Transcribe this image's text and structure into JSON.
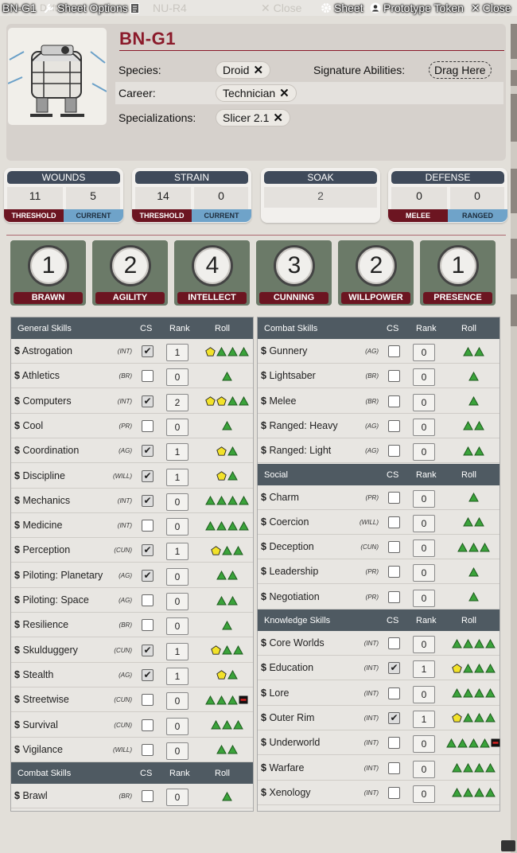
{
  "titlebar": {
    "name": "BN-G1",
    "sheet_options": "Sheet Options",
    "ghost_tab1": "Drift Rock",
    "ghost_tab2": "NU-R4",
    "ghost_close": "Close",
    "sheet": "Sheet",
    "prototype_token": "Prototype Token",
    "close": "Close"
  },
  "character": {
    "name": "BN-G1",
    "species_label": "Species:",
    "species": "Droid",
    "career_label": "Career:",
    "career": "Technician",
    "spec_label": "Specializations:",
    "specialization": "Slicer 2.1",
    "sig_label": "Signature Abilities:",
    "sig_drop": "Drag Here"
  },
  "stats": {
    "wounds": {
      "title": "WOUNDS",
      "threshold": "11",
      "current": "5",
      "l1": "THRESHOLD",
      "l2": "CURRENT"
    },
    "strain": {
      "title": "STRAIN",
      "threshold": "14",
      "current": "0",
      "l1": "THRESHOLD",
      "l2": "CURRENT"
    },
    "soak": {
      "title": "SOAK",
      "value": "2"
    },
    "defense": {
      "title": "DEFENSE",
      "melee": "0",
      "ranged": "0",
      "l1": "MELEE",
      "l2": "RANGED"
    }
  },
  "characteristics": [
    {
      "name": "BRAWN",
      "value": "1"
    },
    {
      "name": "AGILITY",
      "value": "2"
    },
    {
      "name": "INTELLECT",
      "value": "4"
    },
    {
      "name": "CUNNING",
      "value": "3"
    },
    {
      "name": "WILLPOWER",
      "value": "2"
    },
    {
      "name": "PRESENCE",
      "value": "1"
    }
  ],
  "columns": {
    "cs": "CS",
    "rank": "Rank",
    "roll": "Roll"
  },
  "colors": {
    "ability": "#3aa33a",
    "proficiency": "#f2e22a",
    "setback": "#111111",
    "header": "#4f5a62",
    "accent": "#8b1a2a"
  },
  "left_column": [
    {
      "section": "General Skills",
      "rows": [
        {
          "name": "Astrogation",
          "char": "(INT)",
          "cs": true,
          "rank": "1",
          "dice": "YGGG"
        },
        {
          "name": "Athletics",
          "char": "(BR)",
          "cs": false,
          "rank": "0",
          "dice": "G"
        },
        {
          "name": "Computers",
          "char": "(INT)",
          "cs": true,
          "rank": "2",
          "dice": "YYGG"
        },
        {
          "name": "Cool",
          "char": "(PR)",
          "cs": false,
          "rank": "0",
          "dice": "G"
        },
        {
          "name": "Coordination",
          "char": "(AG)",
          "cs": true,
          "rank": "1",
          "dice": "YG"
        },
        {
          "name": "Discipline",
          "char": "(WILL)",
          "cs": true,
          "rank": "1",
          "dice": "YG"
        },
        {
          "name": "Mechanics",
          "char": "(INT)",
          "cs": true,
          "rank": "0",
          "dice": "GGGG"
        },
        {
          "name": "Medicine",
          "char": "(INT)",
          "cs": false,
          "rank": "0",
          "dice": "GGGG"
        },
        {
          "name": "Perception",
          "char": "(CUN)",
          "cs": true,
          "rank": "1",
          "dice": "YGG"
        },
        {
          "name": "Piloting: Planetary",
          "char": "(AG)",
          "cs": true,
          "rank": "0",
          "dice": "GG"
        },
        {
          "name": "Piloting: Space",
          "char": "(AG)",
          "cs": false,
          "rank": "0",
          "dice": "GG"
        },
        {
          "name": "Resilience",
          "char": "(BR)",
          "cs": false,
          "rank": "0",
          "dice": "G"
        },
        {
          "name": "Skulduggery",
          "char": "(CUN)",
          "cs": true,
          "rank": "1",
          "dice": "YGG"
        },
        {
          "name": "Stealth",
          "char": "(AG)",
          "cs": true,
          "rank": "1",
          "dice": "YG"
        },
        {
          "name": "Streetwise",
          "char": "(CUN)",
          "cs": false,
          "rank": "0",
          "dice": "GGGS"
        },
        {
          "name": "Survival",
          "char": "(CUN)",
          "cs": false,
          "rank": "0",
          "dice": "GGG"
        },
        {
          "name": "Vigilance",
          "char": "(WILL)",
          "cs": false,
          "rank": "0",
          "dice": "GG"
        }
      ]
    },
    {
      "section": "Combat Skills",
      "rows": [
        {
          "name": "Brawl",
          "char": "(BR)",
          "cs": false,
          "rank": "0",
          "dice": "G"
        }
      ]
    }
  ],
  "right_column": [
    {
      "section": "Combat Skills",
      "rows": [
        {
          "name": "Gunnery",
          "char": "(AG)",
          "cs": false,
          "rank": "0",
          "dice": "GG"
        },
        {
          "name": "Lightsaber",
          "char": "(BR)",
          "cs": false,
          "rank": "0",
          "dice": "G"
        },
        {
          "name": "Melee",
          "char": "(BR)",
          "cs": false,
          "rank": "0",
          "dice": "G"
        },
        {
          "name": "Ranged: Heavy",
          "char": "(AG)",
          "cs": false,
          "rank": "0",
          "dice": "GG"
        },
        {
          "name": "Ranged: Light",
          "char": "(AG)",
          "cs": false,
          "rank": "0",
          "dice": "GG"
        }
      ]
    },
    {
      "section": "Social",
      "rows": [
        {
          "name": "Charm",
          "char": "(PR)",
          "cs": false,
          "rank": "0",
          "dice": "G"
        },
        {
          "name": "Coercion",
          "char": "(WILL)",
          "cs": false,
          "rank": "0",
          "dice": "GG"
        },
        {
          "name": "Deception",
          "char": "(CUN)",
          "cs": false,
          "rank": "0",
          "dice": "GGG"
        },
        {
          "name": "Leadership",
          "char": "(PR)",
          "cs": false,
          "rank": "0",
          "dice": "G"
        },
        {
          "name": "Negotiation",
          "char": "(PR)",
          "cs": false,
          "rank": "0",
          "dice": "G"
        }
      ]
    },
    {
      "section": "Knowledge Skills",
      "rows": [
        {
          "name": "Core Worlds",
          "char": "(INT)",
          "cs": false,
          "rank": "0",
          "dice": "GGGG"
        },
        {
          "name": "Education",
          "char": "(INT)",
          "cs": true,
          "rank": "1",
          "dice": "YGGG"
        },
        {
          "name": "Lore",
          "char": "(INT)",
          "cs": false,
          "rank": "0",
          "dice": "GGGG"
        },
        {
          "name": "Outer Rim",
          "char": "(INT)",
          "cs": true,
          "rank": "1",
          "dice": "YGGG"
        },
        {
          "name": "Underworld",
          "char": "(INT)",
          "cs": false,
          "rank": "0",
          "dice": "GGGGS"
        },
        {
          "name": "Warfare",
          "char": "(INT)",
          "cs": false,
          "rank": "0",
          "dice": "GGGG"
        },
        {
          "name": "Xenology",
          "char": "(INT)",
          "cs": false,
          "rank": "0",
          "dice": "GGGG"
        }
      ]
    }
  ]
}
